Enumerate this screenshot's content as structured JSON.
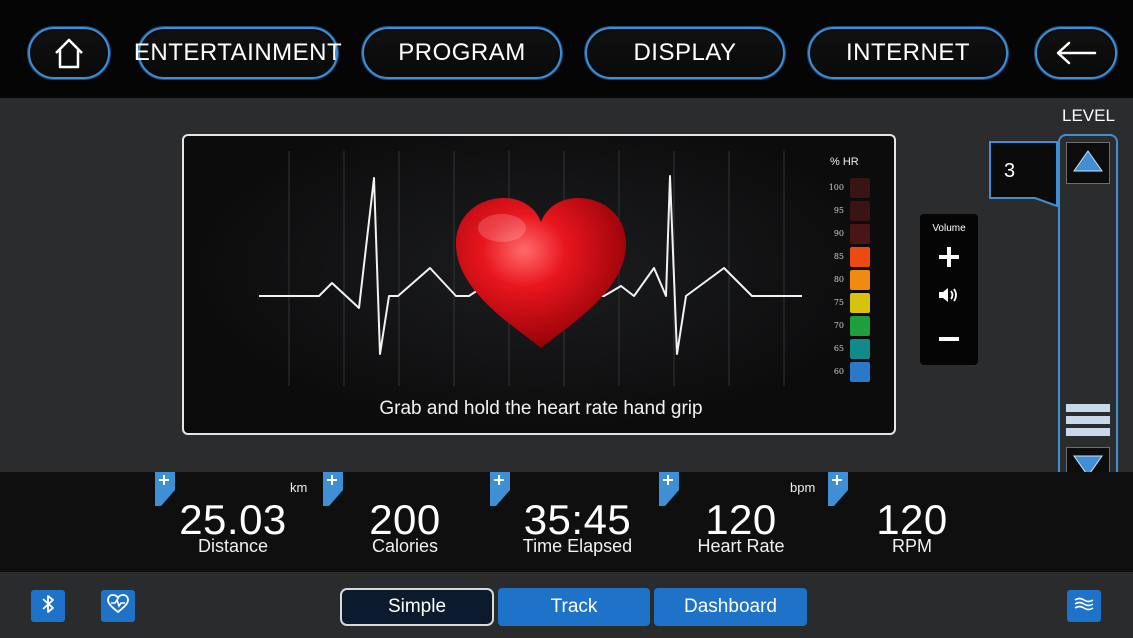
{
  "nav": {
    "home_icon": "home-icon",
    "entertainment": "ENTERTAINMENT",
    "program": "PROGRAM",
    "display": "DISPLAY",
    "internet": "INTERNET",
    "back_icon": "arrow-left-icon"
  },
  "monitor": {
    "prompt": "Grab and hold the heart rate hand grip",
    "scale_title": "% HR",
    "scale": [
      {
        "label": "100",
        "color": "#3a1414"
      },
      {
        "label": "95",
        "color": "#3a1414"
      },
      {
        "label": "90",
        "color": "#4a1515"
      },
      {
        "label": "85",
        "color": "#ec4a12"
      },
      {
        "label": "80",
        "color": "#f08a10"
      },
      {
        "label": "75",
        "color": "#d6c20f"
      },
      {
        "label": "70",
        "color": "#1e9e3c"
      },
      {
        "label": "65",
        "color": "#128a8a"
      },
      {
        "label": "60",
        "color": "#2a78c8"
      }
    ]
  },
  "volume": {
    "label": "Volume",
    "up_icon": "plus-icon",
    "speaker_icon": "speaker-icon",
    "down_icon": "minus-icon"
  },
  "level": {
    "title": "LEVEL",
    "value": "3"
  },
  "stats": [
    {
      "value": "25.03",
      "label": "Distance",
      "unit": "km"
    },
    {
      "value": "200",
      "label": "Calories",
      "unit": ""
    },
    {
      "value": "35:45",
      "label": "Time Elapsed",
      "unit": ""
    },
    {
      "value": "120",
      "label": "Heart Rate",
      "unit": "bpm"
    },
    {
      "value": "120",
      "label": "RPM",
      "unit": ""
    }
  ],
  "bottom": {
    "bluetooth_icon": "bluetooth-icon",
    "heart_icon": "heart-monitor-icon",
    "modes": [
      "Simple",
      "Track",
      "Dashboard"
    ],
    "active_mode": "Simple",
    "menu_icon": "waves-menu-icon"
  },
  "colors": {
    "accent": "#3f8fd4",
    "button": "#1e73c8",
    "heart": "#e0141c"
  }
}
